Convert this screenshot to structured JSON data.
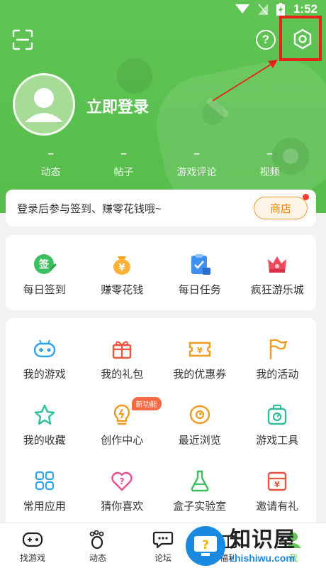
{
  "status": {
    "time": "1:52"
  },
  "header": {
    "login_text": "立即登录",
    "stats": [
      {
        "value": "–",
        "label": "动态"
      },
      {
        "value": "–",
        "label": "帖子"
      },
      {
        "value": "–",
        "label": "游戏评论"
      },
      {
        "value": "–",
        "label": "视频"
      }
    ]
  },
  "signin": {
    "text": "登录后参与签到、赚零花钱哦~",
    "shop_label": "商店"
  },
  "quick_actions": [
    {
      "label": "每日签到",
      "icon": "checkin-icon",
      "icon_glyph": "签"
    },
    {
      "label": "赚零花钱",
      "icon": "money-bag-icon",
      "icon_glyph": "¥"
    },
    {
      "label": "每日任务",
      "icon": "task-clipboard-icon"
    },
    {
      "label": "疯狂游乐城",
      "icon": "crown-castle-icon"
    }
  ],
  "features": [
    {
      "label": "我的游戏",
      "icon": "gamepad-icon"
    },
    {
      "label": "我的礼包",
      "icon": "gift-icon"
    },
    {
      "label": "我的优惠券",
      "icon": "coupon-icon"
    },
    {
      "label": "我的活动",
      "icon": "flag-icon"
    },
    {
      "label": "我的收藏",
      "icon": "star-icon"
    },
    {
      "label": "创作中心",
      "icon": "lightbulb-icon",
      "badge": "新功能"
    },
    {
      "label": "最近浏览",
      "icon": "eye-icon"
    },
    {
      "label": "游戏工具",
      "icon": "toolbox-icon"
    },
    {
      "label": "常用应用",
      "icon": "apps-grid-icon"
    },
    {
      "label": "猜你喜欢",
      "icon": "heart-question-icon",
      "icon_glyph": "?"
    },
    {
      "label": "盒子实验室",
      "icon": "flask-icon"
    },
    {
      "label": "邀请有礼",
      "icon": "invite-gift-icon",
      "icon_glyph": "¥"
    }
  ],
  "bottom_nav": [
    {
      "label": "找游戏",
      "icon": "gamepad-nav-icon"
    },
    {
      "label": "动态",
      "icon": "footprint-icon"
    },
    {
      "label": "论坛",
      "icon": "chat-bubble-icon"
    },
    {
      "label": "福利",
      "icon": "gift-nav-icon"
    },
    {
      "label": "我",
      "icon": "profile-icon"
    }
  ],
  "watermark": {
    "cn": "知识屋",
    "en": "zhishiwu.com",
    "question_mark": "?"
  },
  "colors": {
    "brand_green": "#5fc453",
    "accent_orange": "#f07d00",
    "highlight_red": "#e8211b",
    "watermark_blue": "#1a8ae0"
  }
}
